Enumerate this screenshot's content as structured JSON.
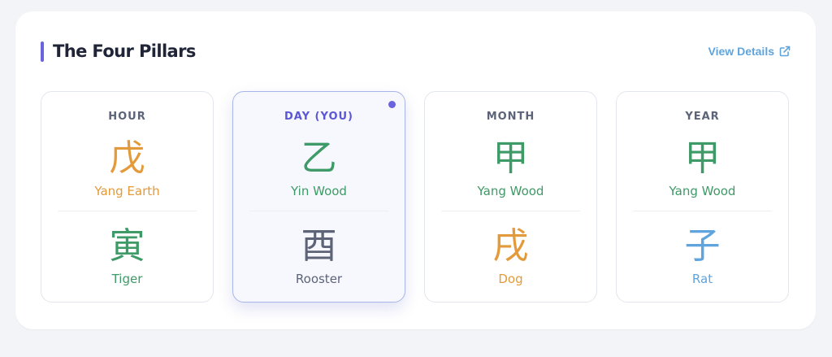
{
  "header": {
    "title": "The Four Pillars",
    "view_details_label": "View Details",
    "accent_color": "#6a63e0",
    "link_color": "#5fa4dc",
    "link_icon": "external-link-icon"
  },
  "pillars": [
    {
      "label": "HOUR",
      "stem": {
        "char": "戊",
        "name": "Yang Earth",
        "color": "#e39a3b"
      },
      "branch": {
        "char": "寅",
        "name": "Tiger",
        "color": "#3e9a66"
      },
      "active": false
    },
    {
      "label": "DAY (YOU)",
      "stem": {
        "char": "乙",
        "name": "Yin Wood",
        "color": "#3e9a66"
      },
      "branch": {
        "char": "酉",
        "name": "Rooster",
        "color": "#5d6478"
      },
      "active": true
    },
    {
      "label": "MONTH",
      "stem": {
        "char": "甲",
        "name": "Yang Wood",
        "color": "#3e9a66"
      },
      "branch": {
        "char": "戌",
        "name": "Dog",
        "color": "#e39a3b"
      },
      "active": false
    },
    {
      "label": "YEAR",
      "stem": {
        "char": "甲",
        "name": "Yang Wood",
        "color": "#3e9a66"
      },
      "branch": {
        "char": "子",
        "name": "Rat",
        "color": "#5fa4dc"
      },
      "active": false
    }
  ]
}
